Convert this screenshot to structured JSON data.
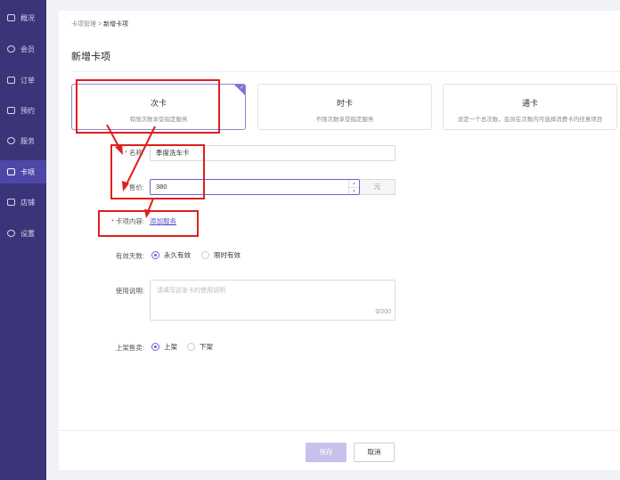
{
  "sidebar": {
    "items": [
      {
        "label": "概况",
        "icon": "monitor-icon"
      },
      {
        "label": "会员",
        "icon": "heart-icon"
      },
      {
        "label": "订单",
        "icon": "list-icon"
      },
      {
        "label": "预约",
        "icon": "calendar-icon"
      },
      {
        "label": "服务",
        "icon": "hand-icon"
      },
      {
        "label": "卡项",
        "icon": "card-icon"
      },
      {
        "label": "店铺",
        "icon": "store-icon"
      },
      {
        "label": "设置",
        "icon": "gear-icon"
      }
    ],
    "active_index": 5
  },
  "breadcrumb": {
    "parent": "卡项管理",
    "separator": ">",
    "current": "新增卡项"
  },
  "page_title": "新增卡项",
  "card_types": [
    {
      "title": "次卡",
      "desc": "有限次数享受指定服务",
      "selected": true
    },
    {
      "title": "时卡",
      "desc": "不限次数享受指定服务",
      "selected": false
    },
    {
      "title": "通卡",
      "desc": "设定一个总次数，会员在次数内可选择消费卡内任意项目",
      "selected": false
    }
  ],
  "form": {
    "name_label": "名称:",
    "name_value": "季度洗车卡",
    "price_label": "售价:",
    "price_value": "380",
    "price_unit": "元",
    "content_label": "卡项内容:",
    "add_service_link": "添加服务",
    "validity_label": "有效天数:",
    "validity_options": [
      "永久有效",
      "限时有效"
    ],
    "validity_selected": 0,
    "desc_label": "使用说明:",
    "desc_placeholder": "请填写这张卡的使用说明",
    "desc_counter": "0/200",
    "shelf_label": "上架售卖:",
    "shelf_options": [
      "上架",
      "下架"
    ],
    "shelf_selected": 0
  },
  "footer": {
    "save_label": "保存",
    "cancel_label": "取消"
  },
  "colors": {
    "sidebar": "#3a3478",
    "accent": "#6d63d6",
    "annotation": "#e01e1e"
  }
}
